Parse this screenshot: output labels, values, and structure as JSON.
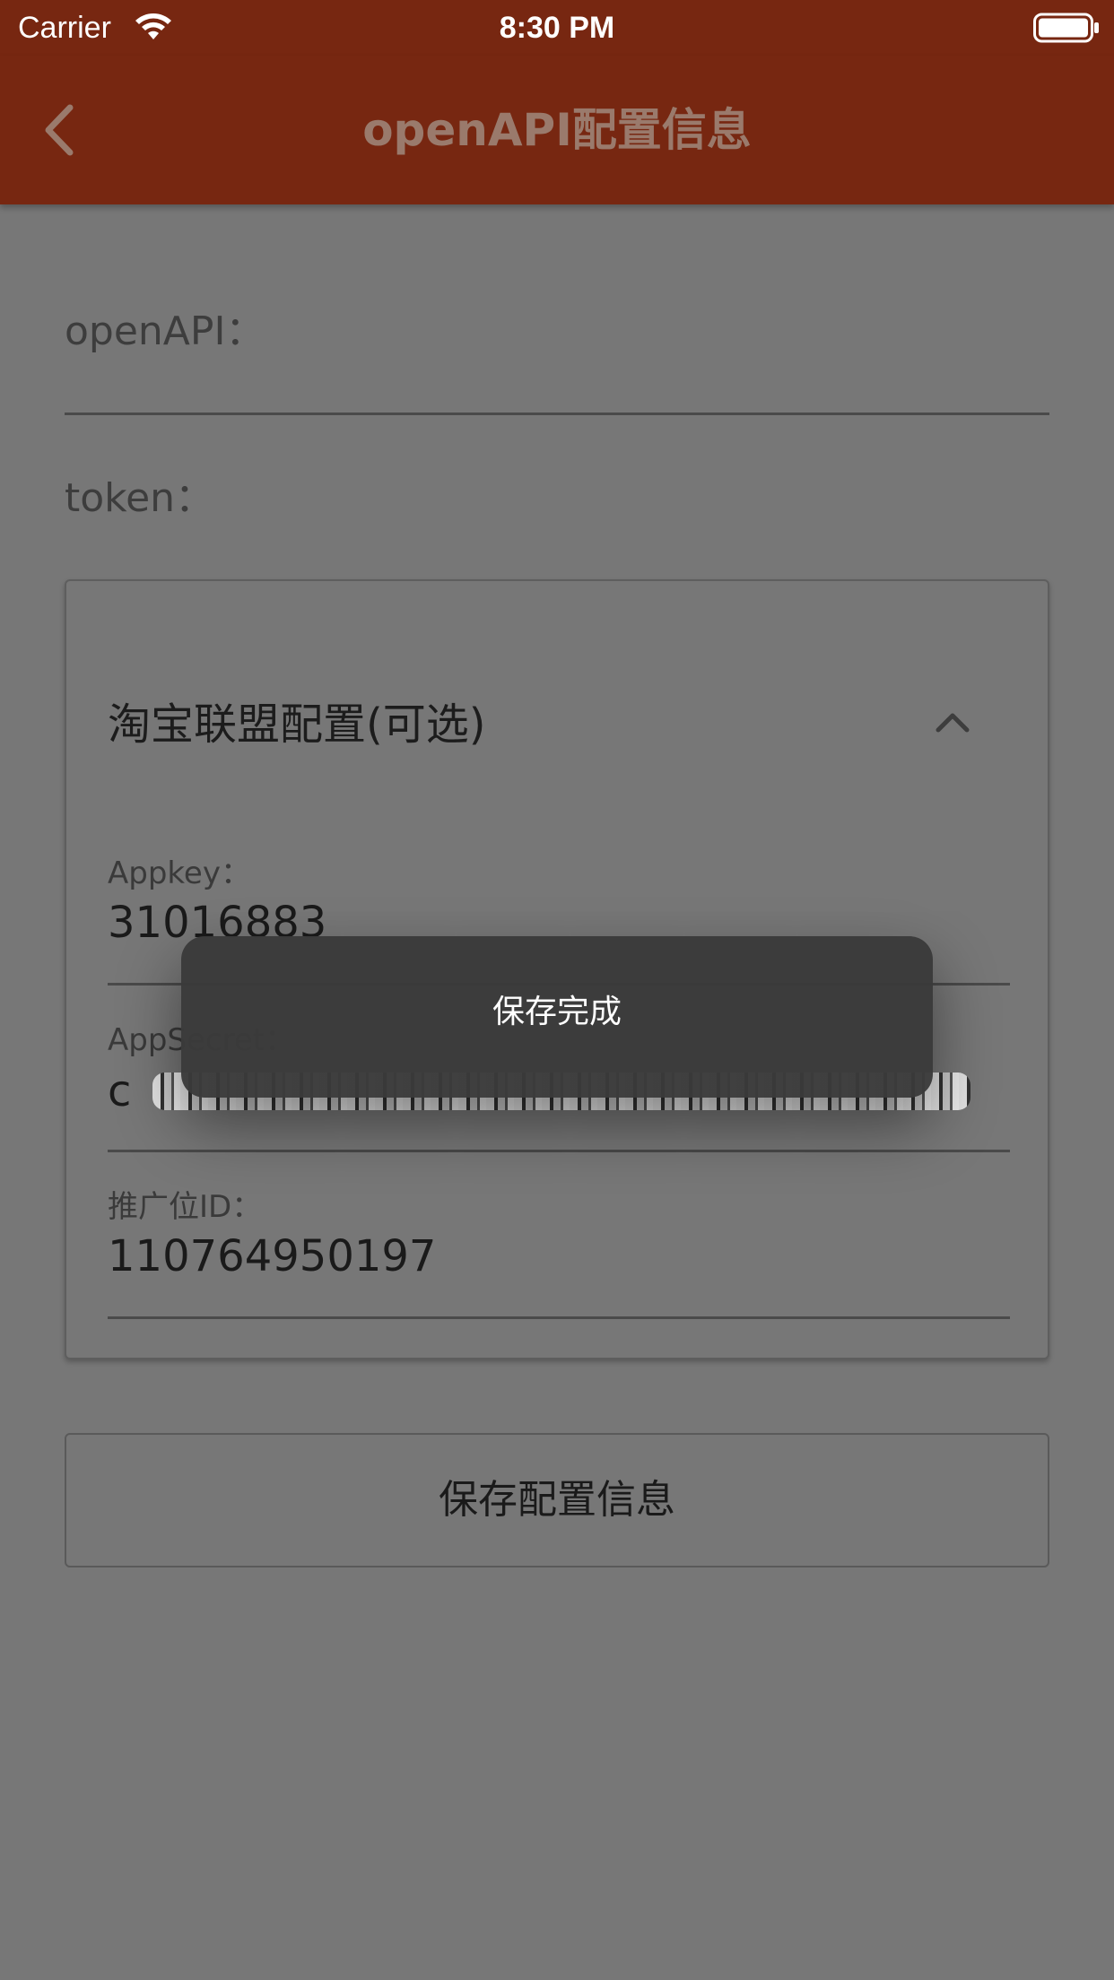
{
  "status_bar": {
    "carrier": "Carrier",
    "time": "8:30 PM",
    "icons": [
      "wifi-icon",
      "battery-icon"
    ]
  },
  "nav": {
    "title": "openAPI配置信息",
    "back_icon": "chevron-left-icon"
  },
  "form": {
    "openapi_label": "openAPI：",
    "token_label": "token："
  },
  "taobao_section": {
    "title": "淘宝联盟配置(可选)",
    "expanded": true,
    "toggle_icon": "chevron-up-icon",
    "fields": [
      {
        "label": "Appkey：",
        "value": "31016883"
      },
      {
        "label": "AppSecret：",
        "value": "c",
        "redacted": true
      },
      {
        "label": "推广位ID：",
        "value": "110764950197"
      }
    ]
  },
  "save_button_label": "保存配置信息",
  "toast": {
    "message": "保存完成"
  },
  "colors": {
    "header": "#772711",
    "overlay_background": "#777777",
    "toast": "#3a3a3a"
  }
}
